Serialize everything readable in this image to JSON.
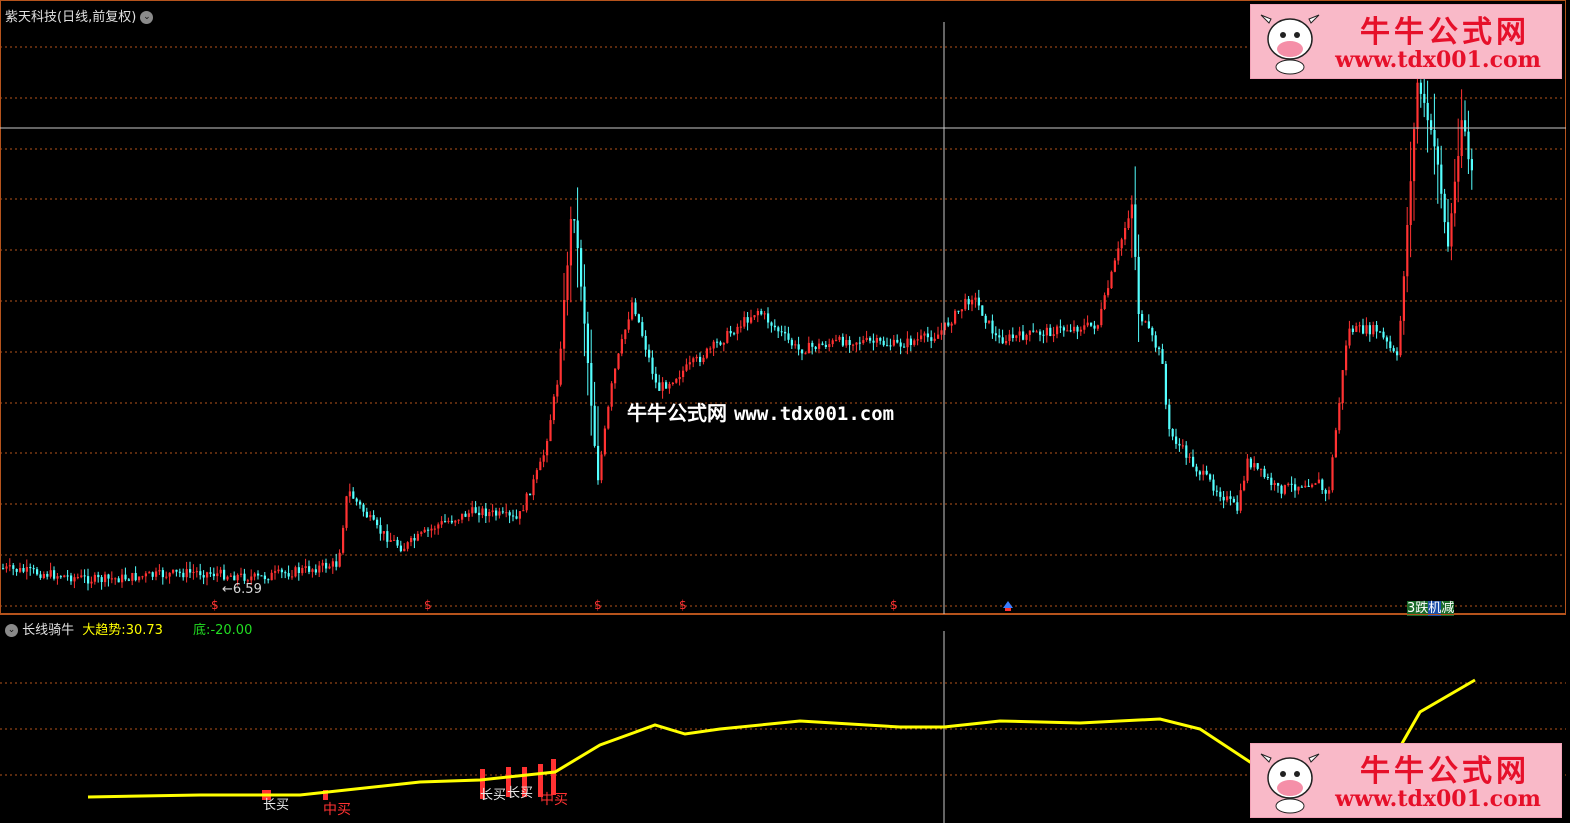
{
  "main_title": {
    "stock": "紫天科技",
    "period": "(日线,前复权)"
  },
  "indicator": {
    "name": "长线骑牛",
    "trend_label": "大趋势:",
    "trend_value": "30.73",
    "bottom_label": "底:",
    "bottom_value": "-20.00"
  },
  "low_price_label": "←6.59",
  "center_watermark": {
    "name": "牛牛公式网",
    "url": "www.tdx001.com"
  },
  "corner_watermark": {
    "title": "牛牛公式网",
    "url": "www.tdx001.com"
  },
  "event_markers": [
    "$",
    "$",
    "$",
    "$",
    "$"
  ],
  "right_badges": [
    "3跌",
    "机",
    "减"
  ],
  "buy_signals": [
    "长买",
    "中买",
    "长买",
    "长买",
    "中买"
  ],
  "colors": {
    "up": "#ff3232",
    "down": "#54ffff",
    "trend_line": "#ffff00",
    "grid": "#b5531c",
    "crosshair": "#c8c8c8",
    "panel_border": "#b5531c",
    "bottom_value": "#22dd22",
    "watermark_bg": "#f9b9c8",
    "watermark_text": "#e6102a"
  }
}
